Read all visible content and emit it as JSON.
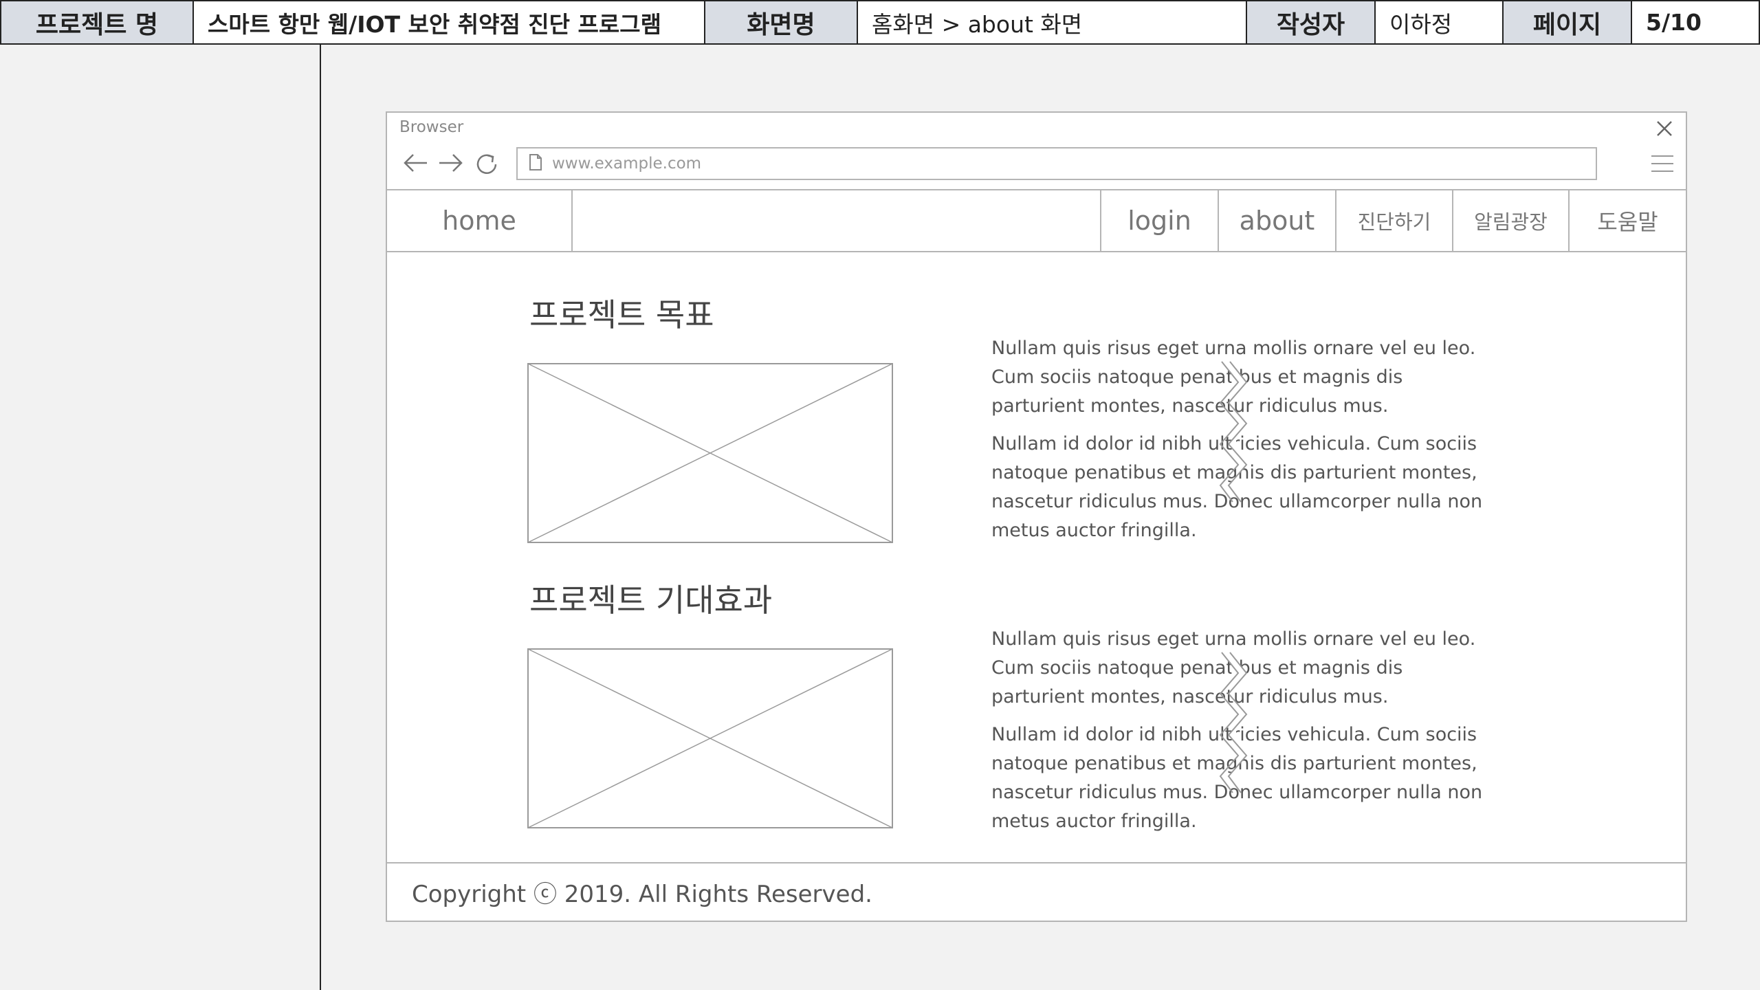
{
  "header": {
    "project_label": "프로젝트 명",
    "project_value": "스마트 항만 웹/IOT 보안 취약점 진단 프로그램",
    "screen_label": "화면명",
    "screen_value": "홈화면 > about 화면",
    "author_label": "작성자",
    "author_value": "이하정",
    "page_label": "페이지",
    "page_value": "5/10"
  },
  "browser": {
    "title": "Browser",
    "url": "www.example.com"
  },
  "nav": {
    "home": "home",
    "login": "login",
    "about": "about",
    "diagnose": "진단하기",
    "notice": "알림광장",
    "help": "도움말"
  },
  "sections": [
    {
      "title": "프로젝트 목표",
      "paragraphs": [
        "Nullam quis risus eget urna mollis ornare vel eu leo. Cum sociis natoque penatibus et magnis dis parturient montes, nascetur ridiculus mus.",
        "Nullam id dolor id nibh ultricies vehicula. Cum sociis natoque penatibus et magnis dis parturient montes, nascetur ridiculus mus. Donec ullamcorper nulla non metus auctor fringilla."
      ]
    },
    {
      "title": "프로젝트 기대효과",
      "paragraphs": [
        "Nullam quis risus eget urna mollis ornare vel eu leo. Cum sociis natoque penatibus et magnis dis parturient montes, nascetur ridiculus mus.",
        "Nullam id dolor id nibh ultricies vehicula. Cum sociis natoque penatibus et magnis dis parturient montes, nascetur ridiculus mus. Donec ullamcorper nulla non metus auctor fringilla."
      ]
    }
  ],
  "footer": {
    "copyright": "Copyright ⓒ 2019. All Rights Reserved."
  },
  "colors": {
    "header_label_bg": "#d9dde4",
    "border": "#b5b5b5",
    "canvas": "#f2f2f2"
  }
}
